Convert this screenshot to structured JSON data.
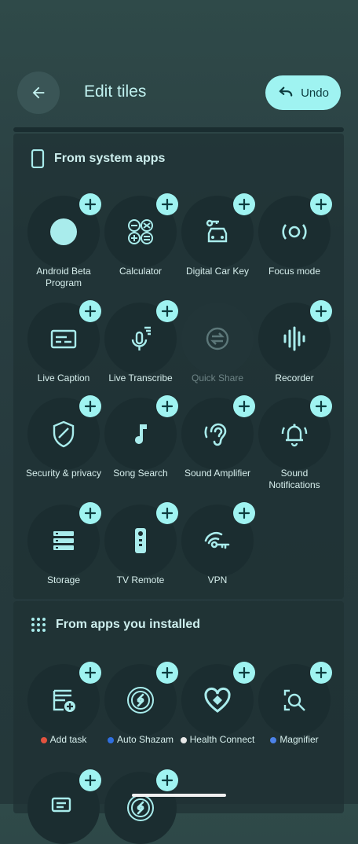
{
  "header": {
    "title": "Edit tiles",
    "undo_label": "Undo"
  },
  "sections": {
    "system": {
      "title": "From system apps"
    },
    "installed": {
      "title": "From apps you installed"
    }
  },
  "system_tiles": [
    {
      "label": "Android Beta Program",
      "icon": "circle-icon"
    },
    {
      "label": "Calculator",
      "icon": "calculator-icon"
    },
    {
      "label": "Digital Car Key",
      "icon": "car-key-icon"
    },
    {
      "label": "Focus mode",
      "icon": "focus-icon"
    },
    {
      "label": "Live Caption",
      "icon": "caption-icon"
    },
    {
      "label": "Live Transcribe",
      "icon": "mic-icon"
    },
    {
      "label": "Quick Share",
      "icon": "share-icon",
      "disabled": true
    },
    {
      "label": "Recorder",
      "icon": "waveform-icon"
    },
    {
      "label": "Security & privacy",
      "icon": "shield-icon"
    },
    {
      "label": "Song Search",
      "icon": "music-note-icon"
    },
    {
      "label": "Sound Amplifier",
      "icon": "ear-icon"
    },
    {
      "label": "Sound Notifications",
      "icon": "bell-icon"
    },
    {
      "label": "Storage",
      "icon": "storage-icon"
    },
    {
      "label": "TV Remote",
      "icon": "remote-icon"
    },
    {
      "label": "VPN",
      "icon": "vpn-key-icon"
    }
  ],
  "installed_tiles": [
    {
      "label": "Add task",
      "icon": "task-icon",
      "badge_color": "#e2533f"
    },
    {
      "label": "Auto Shazam",
      "icon": "shazam-icon",
      "badge_color": "#2f6fe0"
    },
    {
      "label": "Health Connect",
      "icon": "heart-icon",
      "badge_color": "#e8e8e8"
    },
    {
      "label": "Magnifier",
      "icon": "magnifier-icon",
      "badge_color": "#4c82e8"
    }
  ],
  "colors": {
    "accent": "#9ff3f1",
    "tile": "#1b2d30",
    "icon": "#a9ecec"
  }
}
